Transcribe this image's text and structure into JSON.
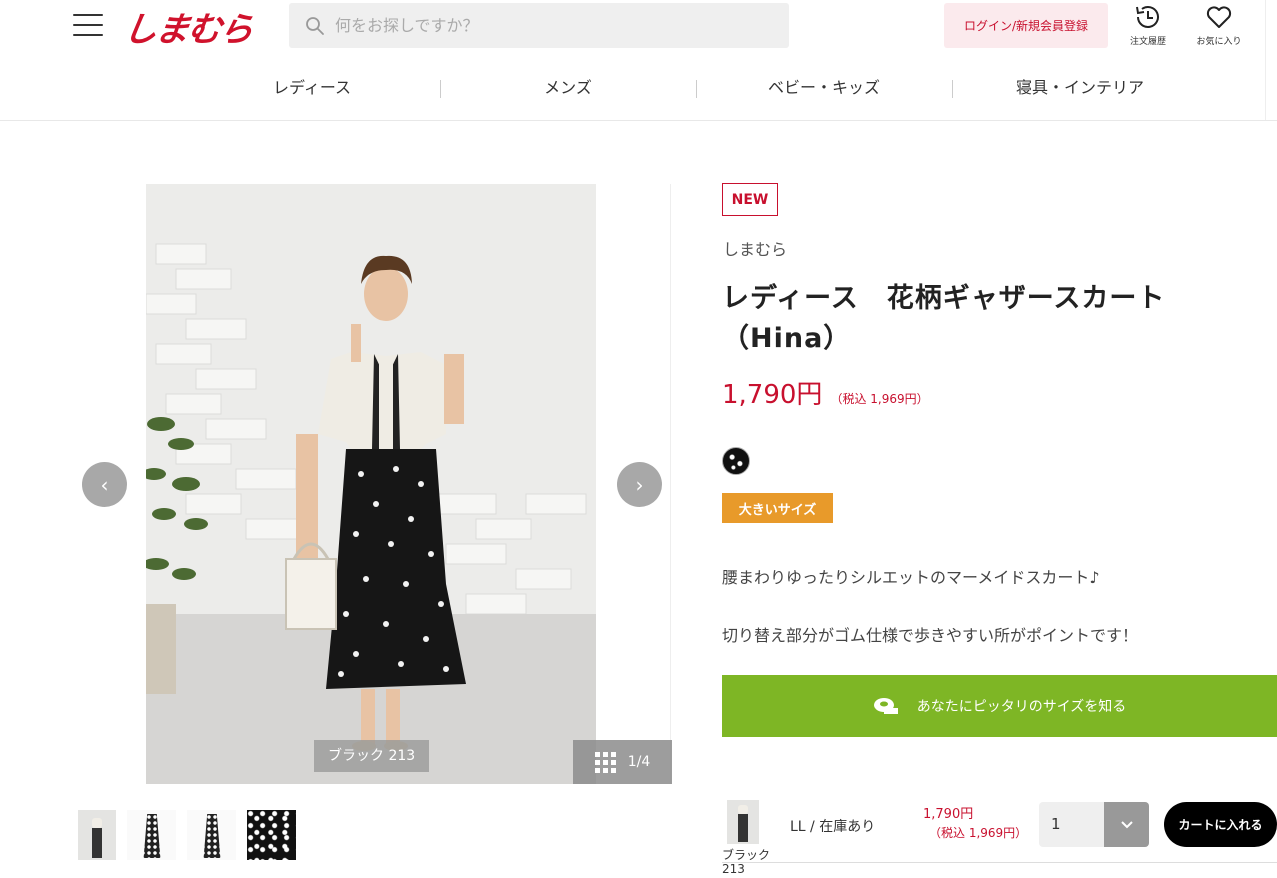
{
  "header": {
    "logo": "しまむら",
    "search_placeholder": "何をお探しですか？",
    "login_label": "ログイン/新規会員登録",
    "history_label": "注文履歴",
    "favorites_label": "お気に入り"
  },
  "nav": {
    "items": [
      {
        "label": "レディース"
      },
      {
        "label": "メンズ"
      },
      {
        "label": "ベビー・キッズ"
      },
      {
        "label": "寝具・インテリア"
      }
    ]
  },
  "gallery": {
    "color_label": "ブラック 213",
    "counter": "1/4",
    "prev": "‹",
    "next": "›"
  },
  "product": {
    "badge": "NEW",
    "brand": "しまむら",
    "title": "レディース　花柄ギャザースカート（Hina）",
    "price": "1,790円",
    "price_tax": "（税込 1,969円）",
    "size_badge": "大きいサイズ",
    "description_1": "腰まわりゆったりシルエットのマーメイドスカート♪",
    "description_2": "切り替え部分がゴム仕様で歩きやすい所がポイントです！",
    "fit_button": "あなたにピッタリのサイズを知る"
  },
  "cart_row": {
    "color": "ブラック 213",
    "size_stock": "LL / 在庫あり",
    "price": "1,790円",
    "price_tax": "（税込 1,969円）",
    "quantity": "1",
    "add_button": "カートに入れる"
  },
  "colors": {
    "brand_red": "#c8102e",
    "fit_green": "#7eb625",
    "size_orange": "#e89a2a"
  }
}
